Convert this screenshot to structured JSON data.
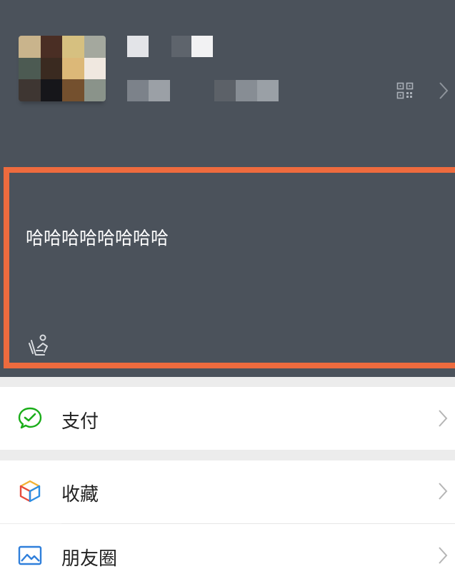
{
  "status": {
    "text": "哈哈哈哈哈哈哈哈"
  },
  "menu": [
    {
      "label": "支付",
      "icon": "pay-icon"
    },
    {
      "label": "收藏",
      "icon": "favorites-cube-icon"
    },
    {
      "label": "朋友圈",
      "icon": "moments-photo-icon"
    }
  ],
  "colors": {
    "header_bg": "#4b525b",
    "highlight_border": "#ee6b3e",
    "pay_green": "#1aad19",
    "divider": "#ececec"
  }
}
